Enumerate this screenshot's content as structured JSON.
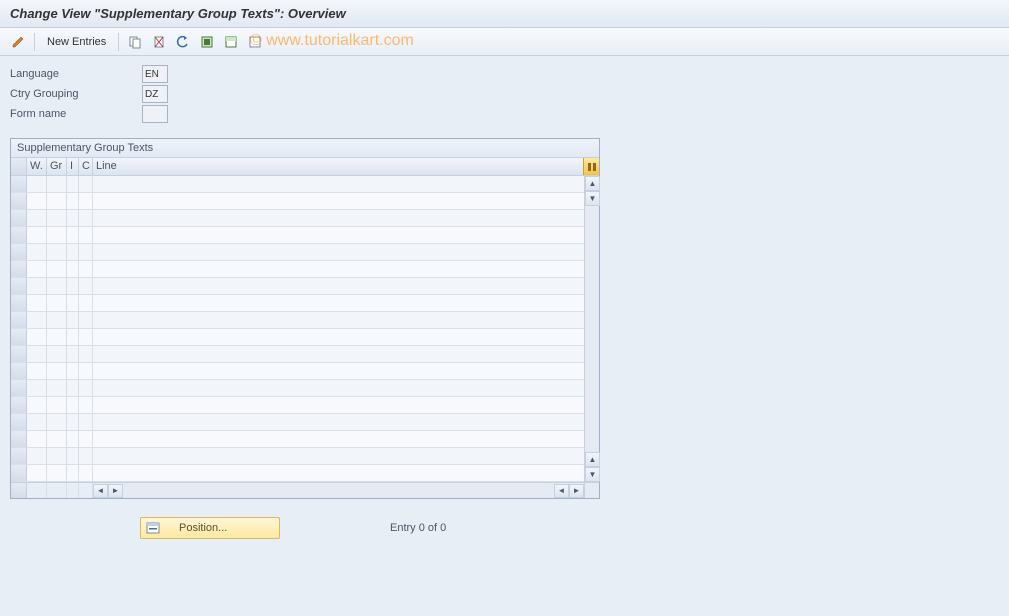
{
  "title": "Change View \"Supplementary Group Texts\": Overview",
  "watermark": "© www.tutorialkart.com",
  "toolbar": {
    "new_entries_label": "New Entries"
  },
  "fields": {
    "language": {
      "label": "Language",
      "value": "EN"
    },
    "ctry_grouping": {
      "label": "Ctry Grouping",
      "value": "DZ"
    },
    "form_name": {
      "label": "Form name",
      "value": ""
    }
  },
  "table": {
    "title": "Supplementary Group Texts",
    "columns": {
      "w": "W.",
      "gr": "Gr",
      "i": "I",
      "c": "C",
      "line": "Line"
    },
    "rows": 18
  },
  "footer": {
    "position_label": "Position...",
    "entry_text": "Entry 0 of 0"
  }
}
